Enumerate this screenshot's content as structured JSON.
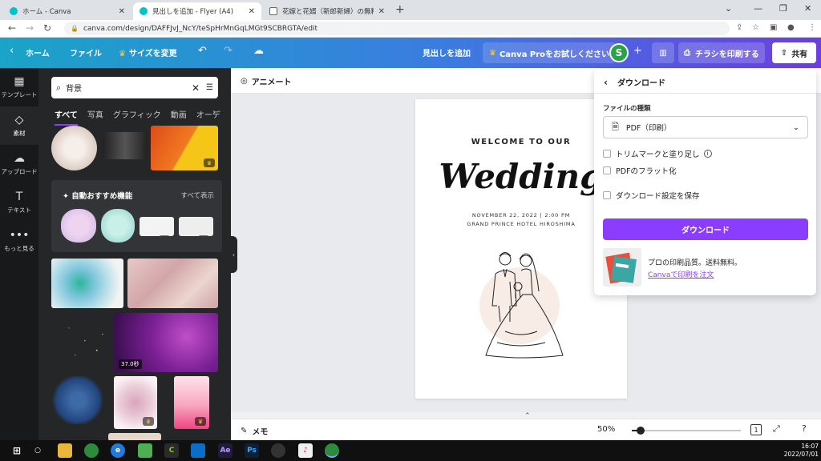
{
  "browser": {
    "tabs": [
      {
        "title": "ホーム - Canva",
        "active": false
      },
      {
        "title": "見出しを追加 - Flyer (A4)",
        "active": true
      },
      {
        "title": "花嫁と花婿（新郎新婦）の無料イ",
        "active": false
      }
    ],
    "url": "canva.com/design/DAFFJvJ_NcY/teSpHrMnGqLMGt9SCBRGTA/edit"
  },
  "header": {
    "home": "ホーム",
    "file": "ファイル",
    "resize": "サイズを変更",
    "doc_title": "見出しを追加",
    "pro_trial": "Canva Proをお試しください",
    "avatar_initial": "S",
    "print": "チラシを印刷する",
    "share": "共有"
  },
  "rail": [
    {
      "label": "テンプレート",
      "icon": "template-icon",
      "active": false
    },
    {
      "label": "素材",
      "icon": "elements-icon",
      "active": true
    },
    {
      "label": "アップロード",
      "icon": "upload-icon",
      "active": false
    },
    {
      "label": "テキスト",
      "icon": "text-icon",
      "active": false
    },
    {
      "label": "もっと見る",
      "icon": "more-icon",
      "active": false
    }
  ],
  "panel": {
    "search_value": "背景",
    "categories": [
      "すべて",
      "写真",
      "グラフィック",
      "動画",
      "オーデ"
    ],
    "auto_title": "自動おすすめ機能",
    "auto_show_all": "すべて表示",
    "video_duration": "37.0秒"
  },
  "toolbar": {
    "animate": "アニメート"
  },
  "design": {
    "welcome": "WELCOME TO OUR",
    "title": "Wedding",
    "date": "NOVEMBER 22, 2022 | 2:00 PM",
    "venue": "GRAND PRINCE HOTEL HIROSHIMA"
  },
  "download": {
    "title": "ダウンロード",
    "file_type_label": "ファイルの種類",
    "file_type_value": "PDF（印刷）",
    "crop_marks": "トリムマークと塗り足し",
    "flatten": "PDFのフラット化",
    "save_settings": "ダウンロード設定を保存",
    "button": "ダウンロード",
    "promo_text": "プロの印刷品質。送料無料。",
    "promo_link": "Canvaで印刷を注文"
  },
  "status": {
    "notes": "メモ",
    "zoom": "50%",
    "zoom_fraction": 0.08,
    "page_count": "1"
  },
  "taskbar": {
    "time": "16:07",
    "date": "2022/07/01"
  },
  "colors": {
    "accent": "#8b3dff",
    "header_start": "#1aa4c8",
    "header_end": "#6b3fe0",
    "avatar": "#2aa14b"
  }
}
